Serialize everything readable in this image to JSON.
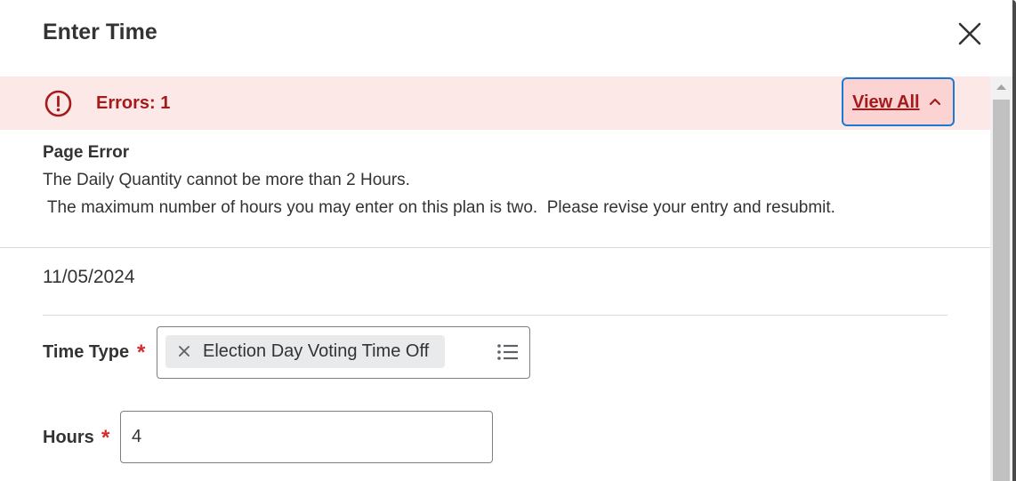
{
  "dialog": {
    "title": "Enter Time",
    "close_icon": "close-icon"
  },
  "error_banner": {
    "icon": "error-exclamation-icon",
    "count_text": "Errors: 1",
    "view_all_label": "View All",
    "view_all_icon": "chevron-up-icon",
    "colors": {
      "background": "#fde8e8",
      "text": "#a31b1b",
      "focus_border": "#1b79d6"
    }
  },
  "page_error": {
    "title": "Page Error",
    "line1": "The Daily Quantity cannot be more than 2 Hours.",
    "line2": " The maximum number of hours you may enter on this plan is two.  Please revise your entry and resubmit."
  },
  "entry": {
    "date": "11/05/2024",
    "time_type": {
      "label": "Time Type",
      "required_marker": "*",
      "selected_value": "Election Day Voting Time Off",
      "remove_icon": "remove-x-icon",
      "prompt_icon": "list-icon"
    },
    "hours": {
      "label": "Hours",
      "required_marker": "*",
      "value": "4"
    }
  },
  "colors": {
    "required": "#d12b2b",
    "text": "#333333"
  }
}
